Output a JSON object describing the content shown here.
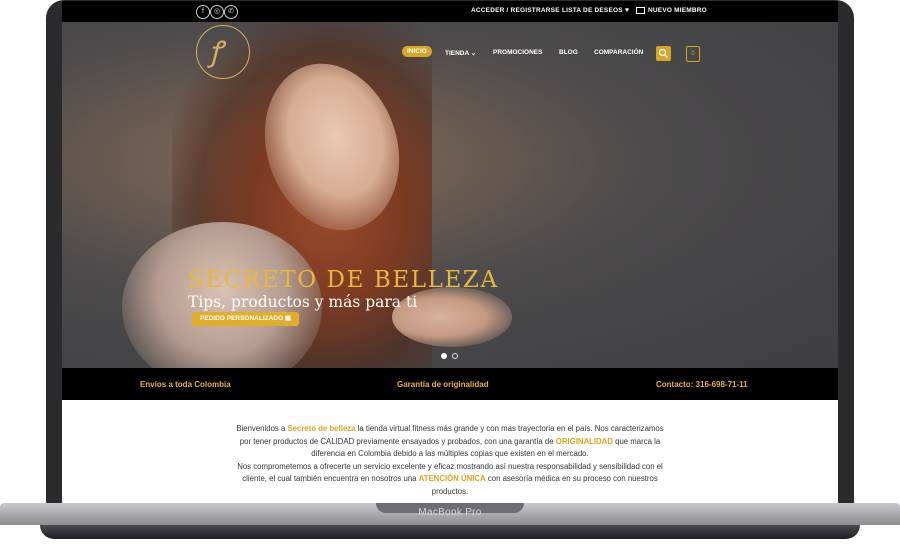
{
  "device": {
    "label": "MacBook Pro"
  },
  "topbar": {
    "social": [
      {
        "icon": "facebook-icon",
        "glyph": "f"
      },
      {
        "icon": "instagram-icon",
        "glyph": "◎"
      },
      {
        "icon": "phone-icon",
        "glyph": "✆"
      }
    ],
    "login": "ACCEDER / REGISTRARSE",
    "wishlist": "LISTA DE DESEOS",
    "wishlist_icon": "♥",
    "new_member": "NUEVO MIEMBRO"
  },
  "nav": {
    "items": [
      "INICIO",
      "TIENDA",
      "PROMOCIONES",
      "BLOG",
      "COMPARACIÓN"
    ],
    "dropdown_glyph": "⌄",
    "cart_count": "0"
  },
  "hero": {
    "title": "SECRETO DE BELLEZA",
    "subtitle": "Tips, productos y más para ti",
    "button": "PEDIDO PERSONALIZADO",
    "slides": 2,
    "active_slide": 1
  },
  "info_strip": {
    "shipping": "Envíos a toda Colombia",
    "guarantee": "Garantía de originalidad",
    "contact": "Contacto: 316-698-71-11"
  },
  "content": {
    "p1_a": "Bienvenidos a ",
    "p1_brand": "Secreto de belleza",
    "p1_b": " la tienda virtual fitness más grande y con mas trayectoria en el país. Nos caracterizamos por tener productos de CALIDAD previamente ensayados y probados, con una garantía de ",
    "p1_orig": "ORIGINALIDAD",
    "p1_c": " que marca la diferencia en Colombia debido a las múltiples copias que existen en el mercado.",
    "p2_a": "Nos comprometemos a ofrecerte un servicio excelente y eficaz mostrando así nuestra responsabilidad y sensibilidad con el cliente, el cual también encuentra en nosotros una ",
    "p2_hl": "ATENCIÓN ÚNICA",
    "p2_b": " con asesoría médica en su proceso con nuestros productos."
  },
  "colors": {
    "accent": "#e3ad2c",
    "dark": "#000000"
  }
}
